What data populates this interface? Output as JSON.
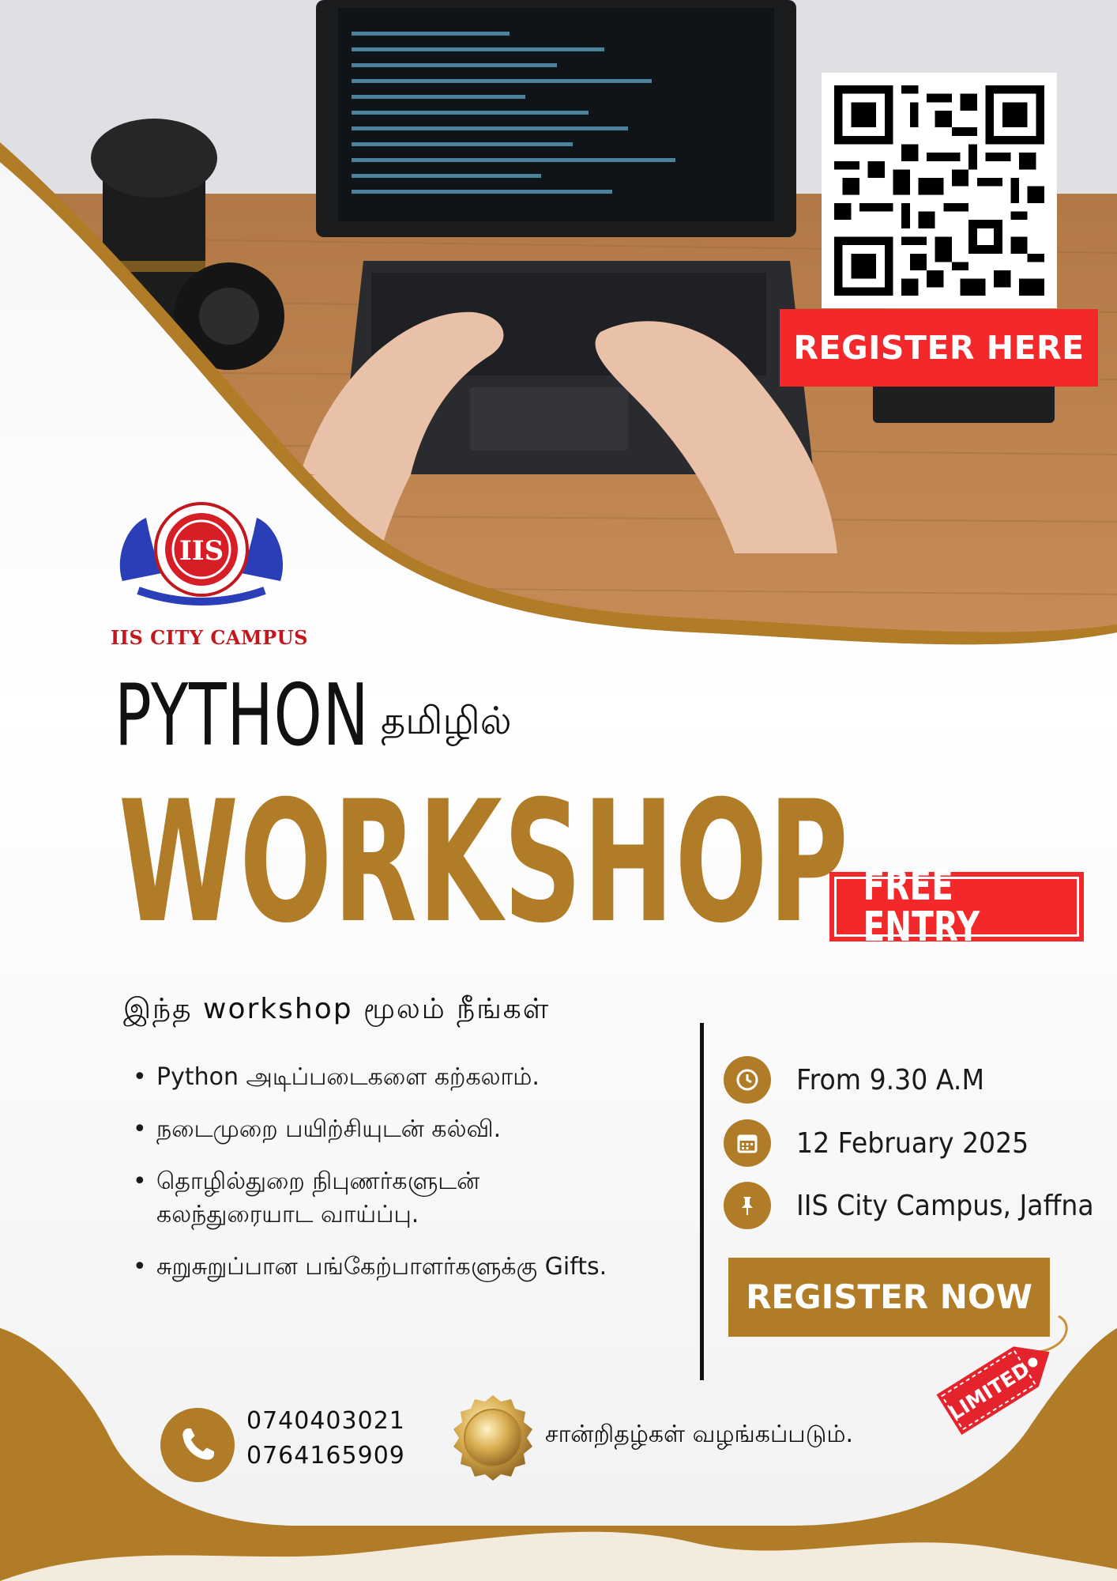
{
  "poster": {
    "qr_cta": "REGISTER HERE",
    "campus_name": "IIS CITY CAMPUS",
    "title_main": "PYTHON",
    "title_tamil": "தமிழில்",
    "title_big": "WORKSHOP",
    "badge": "FREE ENTRY"
  },
  "benefits": {
    "heading": "இந்த workshop மூலம் நீங்கள்",
    "items": [
      "Python அடிப்படைகளை கற்கலாம்.",
      "நடைமுறை பயிற்சியுடன் கல்வி.",
      "தொழில்துறை நிபுணர்களுடன் கலந்துரையாட வாய்ப்பு.",
      "சுறுசுறுப்பான பங்கேற்பாளர்களுக்கு Gifts."
    ]
  },
  "details": {
    "time": "From 9.30 A.M",
    "date": "12 February 2025",
    "place": "IIS City Campus, Jaffna",
    "register_button": "REGISTER NOW",
    "tag": "LIMITED"
  },
  "contact": {
    "phones": [
      "0740403021",
      "0764165909"
    ],
    "certificate_text": "சான்றிதழ்கள் வழங்கப்படும்."
  },
  "colors": {
    "gold": "#b07c27",
    "red": "#f2282b",
    "text": "#111111"
  },
  "icons": [
    "clock-icon",
    "calendar-icon",
    "pin-icon",
    "phone-icon",
    "medal-icon",
    "qr-code-icon"
  ]
}
